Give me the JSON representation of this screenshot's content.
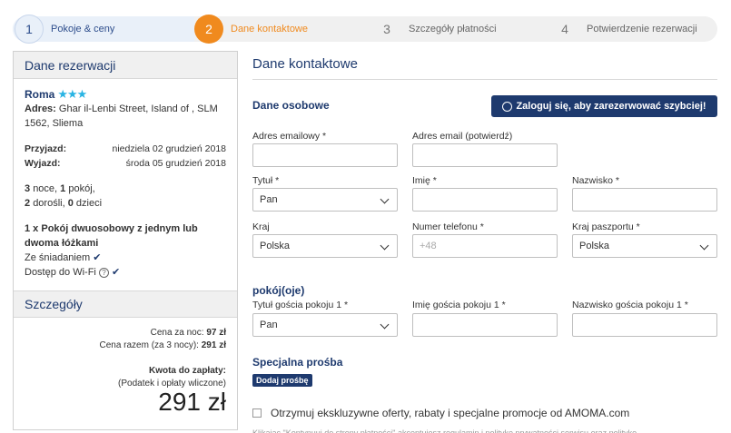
{
  "stepper": {
    "steps": [
      {
        "num": "1",
        "label": "Pokoje & ceny"
      },
      {
        "num": "2",
        "label": "Dane kontaktowe"
      },
      {
        "num": "3",
        "label": "Szczegóły płatności"
      },
      {
        "num": "4",
        "label": "Potwierdzenie rezerwacji"
      }
    ]
  },
  "reservation": {
    "title": "Dane rezerwacji",
    "hotel_name": "Roma",
    "stars": "★★★",
    "address_label": "Adres:",
    "address": "Ghar il-Lenbi Street, Island of , SLM 1562, Sliema",
    "checkin_label": "Przyjazd:",
    "checkin": "niedziela 02 grudzień 2018",
    "checkout_label": "Wyjazd:",
    "checkout": "środa 05 grudzień 2018",
    "nights": "3",
    "nights_text": "noce,",
    "rooms": "1",
    "rooms_text": "pokój,",
    "adults": "2",
    "adults_text": "dorośli,",
    "children": "0",
    "children_text": "dzieci",
    "room_qty": "1 x",
    "room_type": "Pokój dwuosobowy z jednym lub dwoma łóżkami",
    "breakfast": "Ze śniadaniem",
    "wifi": "Dostęp do Wi-Fi",
    "check": "✔",
    "qmark": "?"
  },
  "details": {
    "title": "Szczegóły",
    "per_night_label": "Cena za noc:",
    "per_night": "97 zł",
    "total_label": "Cena razem (za 3 nocy):",
    "total": "291 zł",
    "due_label": "Kwota do zapłaty:",
    "tax_note": "(Podatek i opłaty wliczone)",
    "due_amount": "291 zł"
  },
  "form": {
    "title": "Dane kontaktowe",
    "personal_title": "Dane osobowe",
    "login_button": "Zaloguj się, aby zarezerwować szybciej!",
    "email_label": "Adres emailowy *",
    "email_value": "",
    "email_confirm_label": "Adres email (potwierdź)",
    "email_confirm_value": "",
    "title_label": "Tytuł *",
    "title_value": "Pan",
    "firstname_label": "Imię *",
    "firstname_value": "",
    "lastname_label": "Nazwisko *",
    "lastname_value": "",
    "country_label": "Kraj",
    "country_value": "Polska",
    "phone_label": "Numer telefonu *",
    "phone_placeholder": "+48",
    "passport_label": "Kraj paszportu *",
    "passport_value": "Polska",
    "rooms_title": "pokój(oje)",
    "guest_title_label": "Tytuł gościa pokoju 1 *",
    "guest_title_value": "Pan",
    "guest_first_label": "Imię gościa pokoju 1 *",
    "guest_last_label": "Nazwisko gościa pokoju 1 *",
    "special_title": "Specjalna prośba",
    "add_request_button": "Dodaj prośbę",
    "offers_label": "Otrzymuj ekskluzywne oferty, rabaty i specjalne promocje od AMOMA.com",
    "footer_text": "Klikając \"Kontynuuj do strony płatności\" akceptujesz regulamin i politykę prywatności serwisu oraz politykę"
  }
}
